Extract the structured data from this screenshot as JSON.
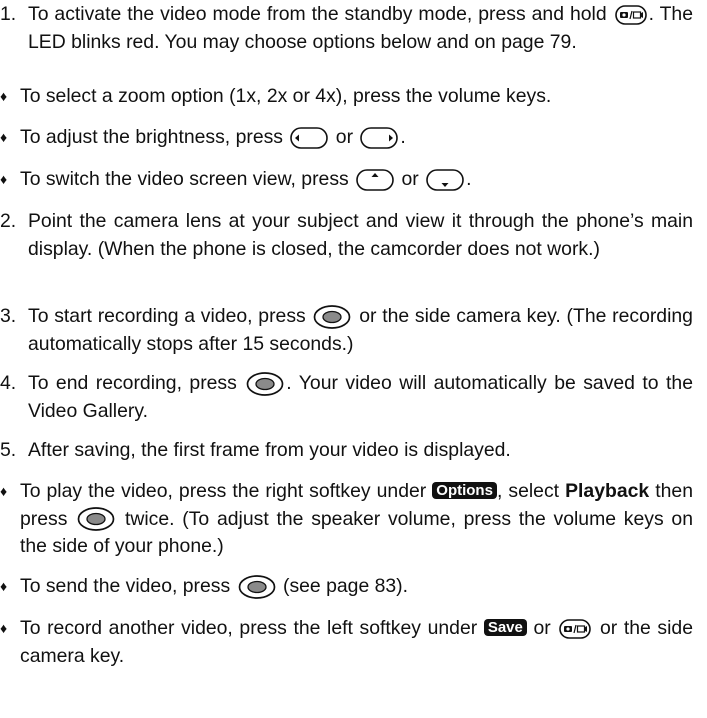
{
  "items": {
    "s1": {
      "num": "1.",
      "a": "To activate the video mode from the standby mode, press and hold",
      "b": ". The LED blinks red. You may choose options below and on page 79."
    },
    "b1": {
      "mark": "♦",
      "a": "To select a zoom option (1x, 2x or 4x), press the volume keys."
    },
    "b2": {
      "mark": "♦",
      "a": "To adjust the brightness, press",
      "or": "or",
      "end": "."
    },
    "b3": {
      "mark": "♦",
      "a": "To switch the video screen view, press",
      "or": "or",
      "end": "."
    },
    "s2": {
      "num": "2.",
      "a": "Point the camera lens at your subject and view it through the phone’s main display. (When the phone is closed, the camcorder does not work.)"
    },
    "s3": {
      "num": "3.",
      "a": "To start recording a video, press",
      "b": "or the side camera key. (The recording automatically stops after 15 seconds.)"
    },
    "s4": {
      "num": "4.",
      "a": "To end recording, press",
      "b": ". Your video will automatically be saved to the Video Gallery."
    },
    "s5": {
      "num": "5.",
      "a": "After saving, the first frame from your video is displayed."
    },
    "b4": {
      "mark": "♦",
      "a": "To play the video, press the right softkey under",
      "softkey": "Options",
      "b": ", select",
      "bold": "Playback",
      "c": "then press",
      "d": "twice. (To adjust the speaker volume, press the volume keys on the side of your phone.)"
    },
    "b5": {
      "mark": "♦",
      "a": "To send the video, press",
      "b": "(see page 83)."
    },
    "b6": {
      "mark": "♦",
      "a": "To record another video, press the left softkey under",
      "softkey": "Save",
      "or": "or",
      "b": "or the side camera key."
    }
  },
  "icons": {
    "camera_video_key": "camera-video-key-icon",
    "nav_left": "nav-left-key-icon",
    "nav_right": "nav-right-key-icon",
    "nav_up": "nav-up-key-icon",
    "nav_down": "nav-down-key-icon",
    "ok_key": "ok-key-icon"
  }
}
